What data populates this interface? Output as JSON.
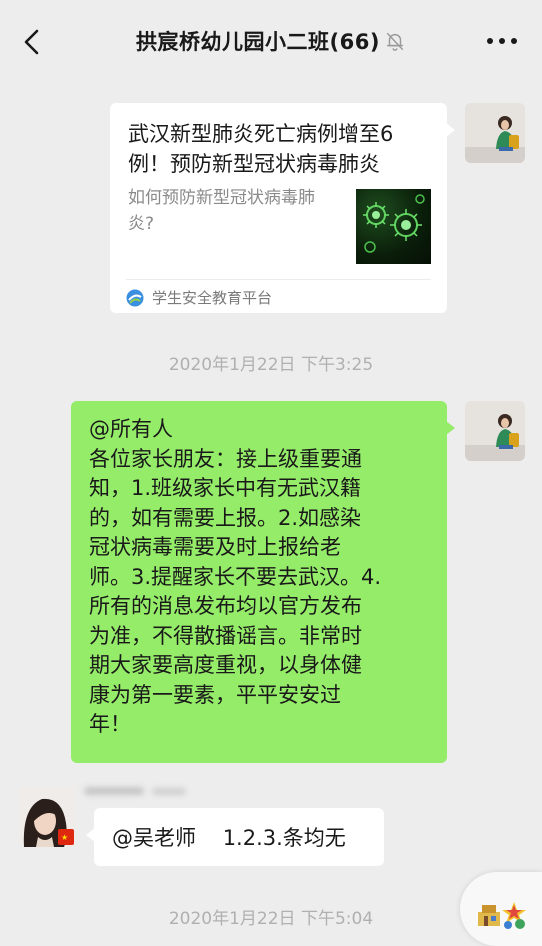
{
  "header": {
    "title": "拱宸桥幼儿园小二班(66)",
    "back_icon": "chevron-left-icon",
    "mute_icon": "bell-muted-icon",
    "more_icon": "more-horizontal-icon"
  },
  "messages": {
    "link_card": {
      "title": "武汉新型肺炎死亡病例增至6例！预防新型冠状病毒肺炎",
      "description": "如何预防新型冠状病毒肺炎?",
      "source": "学生安全教育平台",
      "thumbnail_icon": "virus-image"
    },
    "timestamp_1": "2020年1月22日 下午3:25",
    "notice": {
      "lines": [
        "@所有人",
        "各位家长朋友：接上级重要通",
        "知，1.班级家长中有无武汉籍",
        "的，如有需要上报。2.如感染",
        "冠状病毒需要及时上报给老",
        "师。3.提醒家长不要去武汉。4.",
        "所有的消息发布均以官方发布",
        "为准，不得散播谣言。非常时",
        "期大家要高度重视，以身体健",
        "康为第一要素，平平安安过",
        "年！"
      ]
    },
    "reply": {
      "text": "@吴老师    1.2.3.条均无"
    },
    "timestamp_2": "2020年1月22日 下午5:04"
  },
  "colors": {
    "background": "#ededed",
    "self_bubble": "#95ec69",
    "other_bubble": "#ffffff",
    "timestamp_text": "#b0b0b0",
    "source_icon_blue": "#3b8fe0"
  }
}
